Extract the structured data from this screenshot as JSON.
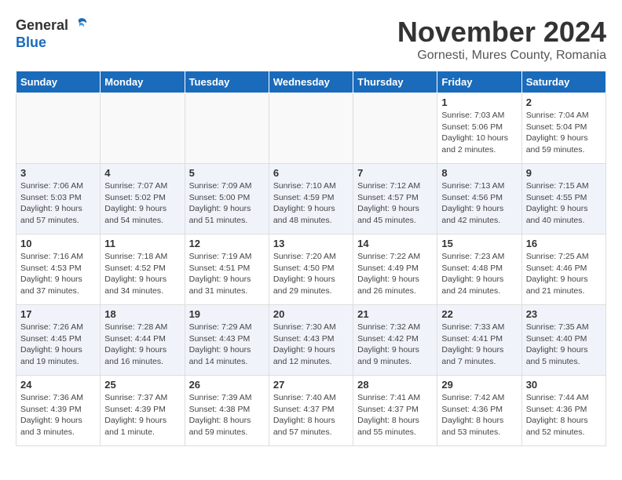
{
  "logo": {
    "general": "General",
    "blue": "Blue"
  },
  "title": "November 2024",
  "subtitle": "Gornesti, Mures County, Romania",
  "days_of_week": [
    "Sunday",
    "Monday",
    "Tuesday",
    "Wednesday",
    "Thursday",
    "Friday",
    "Saturday"
  ],
  "weeks": [
    [
      {
        "day": "",
        "info": ""
      },
      {
        "day": "",
        "info": ""
      },
      {
        "day": "",
        "info": ""
      },
      {
        "day": "",
        "info": ""
      },
      {
        "day": "",
        "info": ""
      },
      {
        "day": "1",
        "info": "Sunrise: 7:03 AM\nSunset: 5:06 PM\nDaylight: 10 hours\nand 2 minutes."
      },
      {
        "day": "2",
        "info": "Sunrise: 7:04 AM\nSunset: 5:04 PM\nDaylight: 9 hours\nand 59 minutes."
      }
    ],
    [
      {
        "day": "3",
        "info": "Sunrise: 7:06 AM\nSunset: 5:03 PM\nDaylight: 9 hours\nand 57 minutes."
      },
      {
        "day": "4",
        "info": "Sunrise: 7:07 AM\nSunset: 5:02 PM\nDaylight: 9 hours\nand 54 minutes."
      },
      {
        "day": "5",
        "info": "Sunrise: 7:09 AM\nSunset: 5:00 PM\nDaylight: 9 hours\nand 51 minutes."
      },
      {
        "day": "6",
        "info": "Sunrise: 7:10 AM\nSunset: 4:59 PM\nDaylight: 9 hours\nand 48 minutes."
      },
      {
        "day": "7",
        "info": "Sunrise: 7:12 AM\nSunset: 4:57 PM\nDaylight: 9 hours\nand 45 minutes."
      },
      {
        "day": "8",
        "info": "Sunrise: 7:13 AM\nSunset: 4:56 PM\nDaylight: 9 hours\nand 42 minutes."
      },
      {
        "day": "9",
        "info": "Sunrise: 7:15 AM\nSunset: 4:55 PM\nDaylight: 9 hours\nand 40 minutes."
      }
    ],
    [
      {
        "day": "10",
        "info": "Sunrise: 7:16 AM\nSunset: 4:53 PM\nDaylight: 9 hours\nand 37 minutes."
      },
      {
        "day": "11",
        "info": "Sunrise: 7:18 AM\nSunset: 4:52 PM\nDaylight: 9 hours\nand 34 minutes."
      },
      {
        "day": "12",
        "info": "Sunrise: 7:19 AM\nSunset: 4:51 PM\nDaylight: 9 hours\nand 31 minutes."
      },
      {
        "day": "13",
        "info": "Sunrise: 7:20 AM\nSunset: 4:50 PM\nDaylight: 9 hours\nand 29 minutes."
      },
      {
        "day": "14",
        "info": "Sunrise: 7:22 AM\nSunset: 4:49 PM\nDaylight: 9 hours\nand 26 minutes."
      },
      {
        "day": "15",
        "info": "Sunrise: 7:23 AM\nSunset: 4:48 PM\nDaylight: 9 hours\nand 24 minutes."
      },
      {
        "day": "16",
        "info": "Sunrise: 7:25 AM\nSunset: 4:46 PM\nDaylight: 9 hours\nand 21 minutes."
      }
    ],
    [
      {
        "day": "17",
        "info": "Sunrise: 7:26 AM\nSunset: 4:45 PM\nDaylight: 9 hours\nand 19 minutes."
      },
      {
        "day": "18",
        "info": "Sunrise: 7:28 AM\nSunset: 4:44 PM\nDaylight: 9 hours\nand 16 minutes."
      },
      {
        "day": "19",
        "info": "Sunrise: 7:29 AM\nSunset: 4:43 PM\nDaylight: 9 hours\nand 14 minutes."
      },
      {
        "day": "20",
        "info": "Sunrise: 7:30 AM\nSunset: 4:43 PM\nDaylight: 9 hours\nand 12 minutes."
      },
      {
        "day": "21",
        "info": "Sunrise: 7:32 AM\nSunset: 4:42 PM\nDaylight: 9 hours\nand 9 minutes."
      },
      {
        "day": "22",
        "info": "Sunrise: 7:33 AM\nSunset: 4:41 PM\nDaylight: 9 hours\nand 7 minutes."
      },
      {
        "day": "23",
        "info": "Sunrise: 7:35 AM\nSunset: 4:40 PM\nDaylight: 9 hours\nand 5 minutes."
      }
    ],
    [
      {
        "day": "24",
        "info": "Sunrise: 7:36 AM\nSunset: 4:39 PM\nDaylight: 9 hours\nand 3 minutes."
      },
      {
        "day": "25",
        "info": "Sunrise: 7:37 AM\nSunset: 4:39 PM\nDaylight: 9 hours\nand 1 minute."
      },
      {
        "day": "26",
        "info": "Sunrise: 7:39 AM\nSunset: 4:38 PM\nDaylight: 8 hours\nand 59 minutes."
      },
      {
        "day": "27",
        "info": "Sunrise: 7:40 AM\nSunset: 4:37 PM\nDaylight: 8 hours\nand 57 minutes."
      },
      {
        "day": "28",
        "info": "Sunrise: 7:41 AM\nSunset: 4:37 PM\nDaylight: 8 hours\nand 55 minutes."
      },
      {
        "day": "29",
        "info": "Sunrise: 7:42 AM\nSunset: 4:36 PM\nDaylight: 8 hours\nand 53 minutes."
      },
      {
        "day": "30",
        "info": "Sunrise: 7:44 AM\nSunset: 4:36 PM\nDaylight: 8 hours\nand 52 minutes."
      }
    ]
  ]
}
